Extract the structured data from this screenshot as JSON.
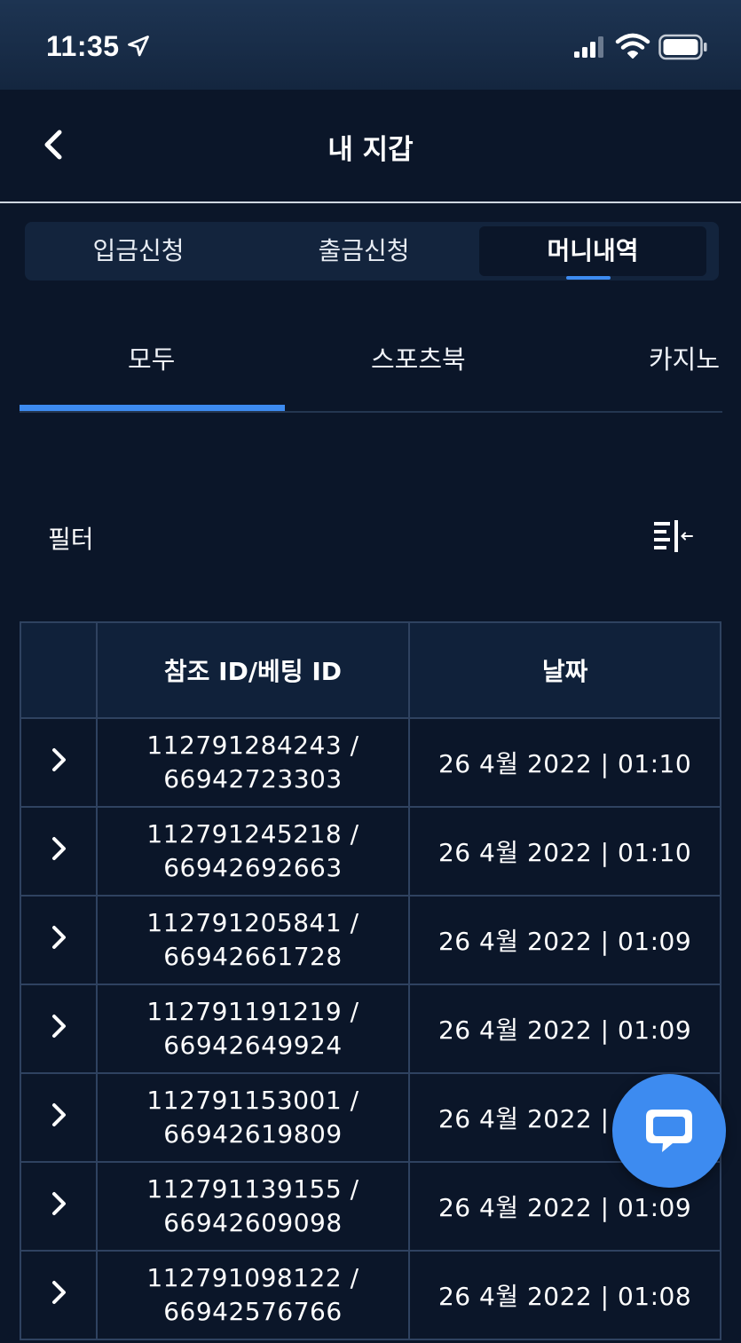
{
  "status_bar": {
    "time": "11:35"
  },
  "header": {
    "title": "내 지갑"
  },
  "segments": [
    {
      "label": "입금신청",
      "active": false
    },
    {
      "label": "출금신청",
      "active": false
    },
    {
      "label": "머니내역",
      "active": true
    }
  ],
  "subtabs": [
    {
      "label": "모두",
      "active": true
    },
    {
      "label": "스포츠북",
      "active": false
    },
    {
      "label": "카지노",
      "active": false
    }
  ],
  "filter": {
    "label": "필터"
  },
  "table": {
    "headers": [
      "",
      "참조 ID/베팅 ID",
      "날짜"
    ],
    "rows": [
      {
        "ref_id": "112791284243 /",
        "bet_id": "66942723303",
        "date": "26 4월 2022 | 01:10"
      },
      {
        "ref_id": "112791245218 /",
        "bet_id": "66942692663",
        "date": "26 4월 2022 | 01:10"
      },
      {
        "ref_id": "112791205841 /",
        "bet_id": "66942661728",
        "date": "26 4월 2022 | 01:09"
      },
      {
        "ref_id": "112791191219 /",
        "bet_id": "66942649924",
        "date": "26 4월 2022 | 01:09"
      },
      {
        "ref_id": "112791153001 /",
        "bet_id": "66942619809",
        "date": "26 4월 2022 | 01:09"
      },
      {
        "ref_id": "112791139155 /",
        "bet_id": "66942609098",
        "date": "26 4월 2022 | 01:09"
      },
      {
        "ref_id": "112791098122 /",
        "bet_id": "66942576766",
        "date": "26 4월 2022 | 01:08"
      }
    ]
  },
  "colors": {
    "background": "#0b1629",
    "accent": "#3d8bf0",
    "table_border": "#2f4260"
  },
  "icons": [
    "location-arrow-icon",
    "signal-icon",
    "wifi-icon",
    "battery-icon",
    "back-chevron-icon",
    "filter-icon",
    "chevron-right-icon",
    "chat-icon"
  ]
}
